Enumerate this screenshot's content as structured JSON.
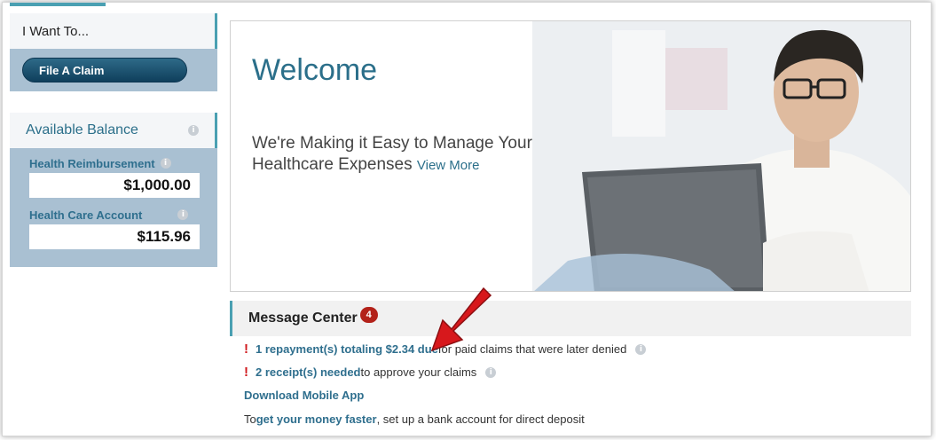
{
  "sidebar": {
    "want_to": {
      "title": "I Want To...",
      "file_claim_label": "File A Claim"
    },
    "balance": {
      "title": "Available Balance",
      "accounts": [
        {
          "label": "Health Reimbursement",
          "value": "$1,000.00"
        },
        {
          "label": "Health Care Account",
          "value": "$115.96"
        }
      ]
    }
  },
  "hero": {
    "title": "Welcome",
    "subtitle": "We're Making it Easy to Manage Your Healthcare Expenses",
    "view_more": "View More"
  },
  "messages": {
    "title": "Message Center",
    "count": "4",
    "alert_mark": "!",
    "items": [
      {
        "link": "1 repayment(s) totaling $2.34 due",
        "rest": " for paid claims that were later denied"
      },
      {
        "link": "2 receipt(s) needed",
        "rest": " to approve your claims"
      }
    ],
    "download_app": "Download Mobile App",
    "bank_prefix": "To ",
    "bank_link": "get your money faster",
    "bank_rest": " , set up a bank account for direct deposit"
  },
  "colors": {
    "accent": "#4aa0b2",
    "link": "#2f6f8e",
    "alert": "#d0191d",
    "badge": "#b3221a",
    "panel_blue": "#a9c0d2"
  },
  "icons": [
    "info-icon",
    "red-arrow-icon"
  ]
}
